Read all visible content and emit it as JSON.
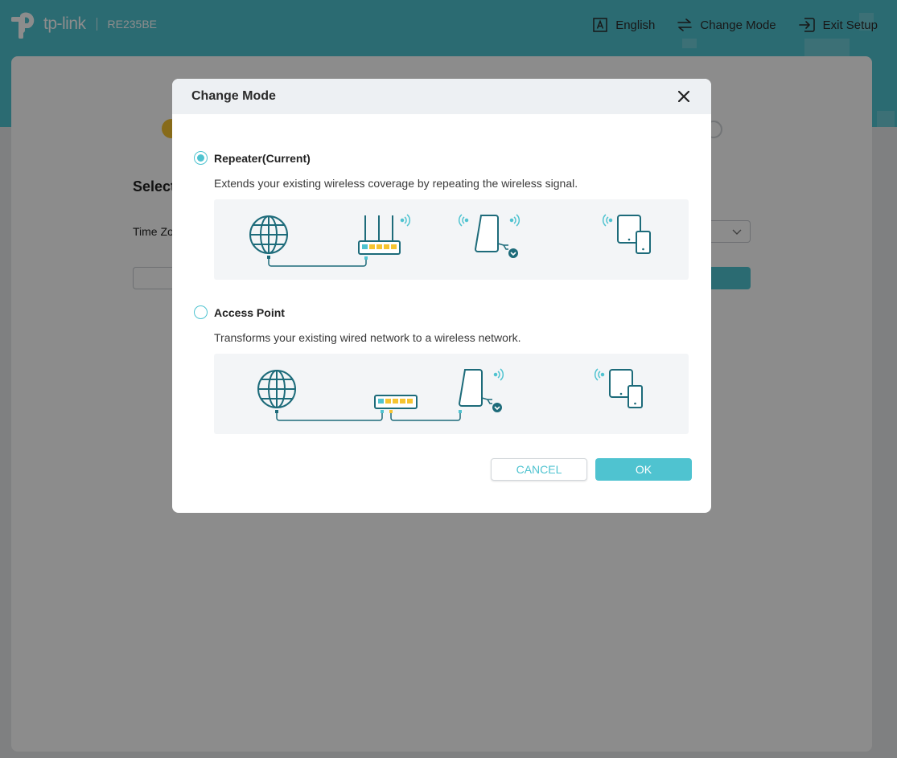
{
  "header": {
    "brand": "tp-link",
    "model": "RE235BE",
    "nav": [
      {
        "label": "English",
        "icon": "language-icon"
      },
      {
        "label": "Change Mode",
        "icon": "change-mode-icon"
      },
      {
        "label": "Exit Setup",
        "icon": "exit-icon"
      }
    ]
  },
  "page": {
    "heading": "Select",
    "time_zone_label": "Time Zo"
  },
  "modal": {
    "title": "Change Mode",
    "options": [
      {
        "label": "Repeater(Current)",
        "selected": true,
        "description": "Extends your existing wireless coverage by repeating the wireless signal."
      },
      {
        "label": "Access Point",
        "selected": false,
        "description": "Transforms your existing wired network to a wireless network."
      }
    ],
    "cancel_label": "CANCEL",
    "ok_label": "OK"
  },
  "colors": {
    "accent": "#4fc3d0",
    "icon_stroke": "#1d6b7a",
    "port_yellow": "#f6c431",
    "overlay": "rgba(0,0,0,0.45)"
  }
}
